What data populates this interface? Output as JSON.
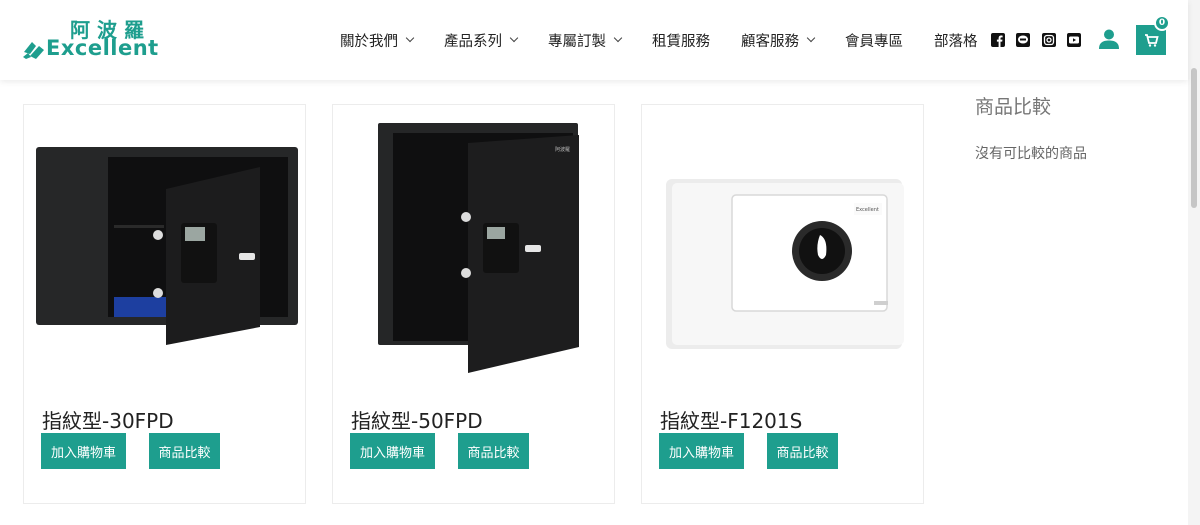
{
  "logo": {
    "cn": "阿波羅",
    "en": "Excellent"
  },
  "nav": [
    {
      "label": "關於我們",
      "dropdown": true
    },
    {
      "label": "產品系列",
      "dropdown": true
    },
    {
      "label": "專屬訂製",
      "dropdown": true
    },
    {
      "label": "租賃服務",
      "dropdown": false
    },
    {
      "label": "顧客服務",
      "dropdown": true
    },
    {
      "label": "會員專區",
      "dropdown": false
    },
    {
      "label": "部落格",
      "dropdown": false
    }
  ],
  "social_icons": [
    "facebook-icon",
    "line-icon",
    "instagram-icon",
    "youtube-icon"
  ],
  "cart": {
    "count": "0"
  },
  "accent_color": "#1e9e8e",
  "products": [
    {
      "name": "指紋型-30FPD",
      "add_to_cart": "加入購物車",
      "compare": "商品比較"
    },
    {
      "name": "指紋型-50FPD",
      "add_to_cart": "加入購物車",
      "compare": "商品比較"
    },
    {
      "name": "指紋型-F1201S",
      "add_to_cart": "加入購物車",
      "compare": "商品比較"
    }
  ],
  "sidebar": {
    "title": "商品比較",
    "empty_text": "沒有可比較的商品"
  }
}
